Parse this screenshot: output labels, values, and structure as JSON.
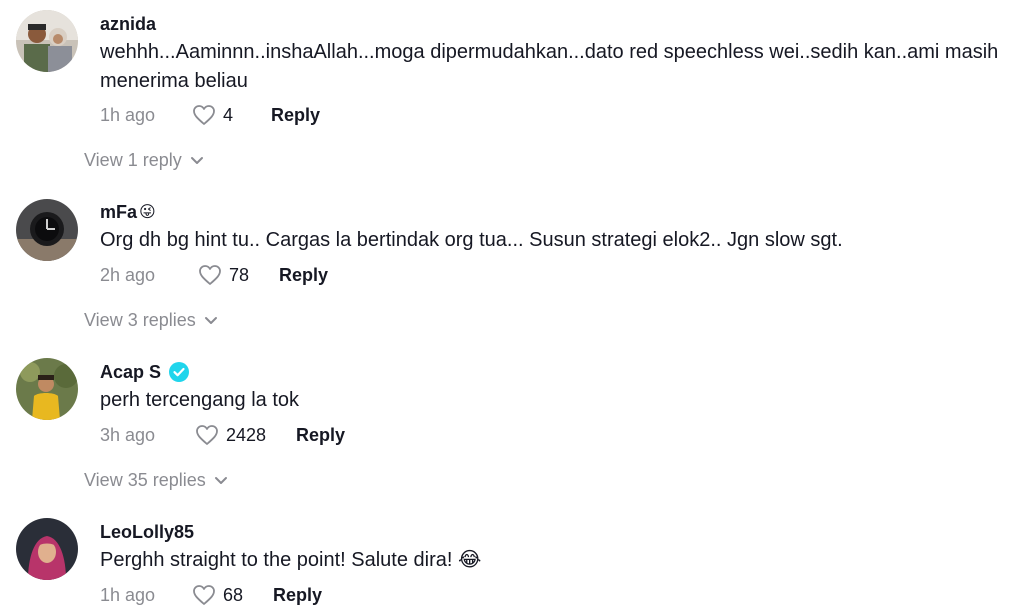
{
  "comments": [
    {
      "username": "aznida",
      "username_emoji": "",
      "verified": false,
      "text": "wehhh...Aaminnn..inshaAllah...moga dipermudahkan...dato red speechless wei..sedih kan..ami masih menerima beliau",
      "time": "1h ago",
      "likes": "4",
      "reply_label": "Reply",
      "view_replies": "View 1 reply",
      "avatar_icon": "couple-photo"
    },
    {
      "username": "mFa",
      "username_emoji": "😜",
      "verified": false,
      "text": "Org dh bg hint tu.. Cargas la bertindak org tua... Susun strategi elok2.. Jgn slow sgt.",
      "time": "2h ago",
      "likes": "78",
      "reply_label": "Reply",
      "view_replies": "View 3 replies",
      "avatar_icon": "watch-photo"
    },
    {
      "username": "Acap S",
      "username_emoji": "",
      "verified": true,
      "text": "perh tercengang la tok",
      "time": "3h ago",
      "likes": "2428",
      "reply_label": "Reply",
      "view_replies": "View 35 replies",
      "avatar_icon": "person-photo"
    },
    {
      "username": "LeoLolly85",
      "username_emoji": "",
      "verified": false,
      "text": "Perghh straight to the point! Salute dira! 😂",
      "time": "1h ago",
      "likes": "68",
      "reply_label": "Reply",
      "view_replies": "",
      "avatar_icon": "hijab-woman-photo"
    }
  ],
  "colors": {
    "text": "#161823",
    "muted": "#8a8b91",
    "verified": "#20d5ec"
  }
}
